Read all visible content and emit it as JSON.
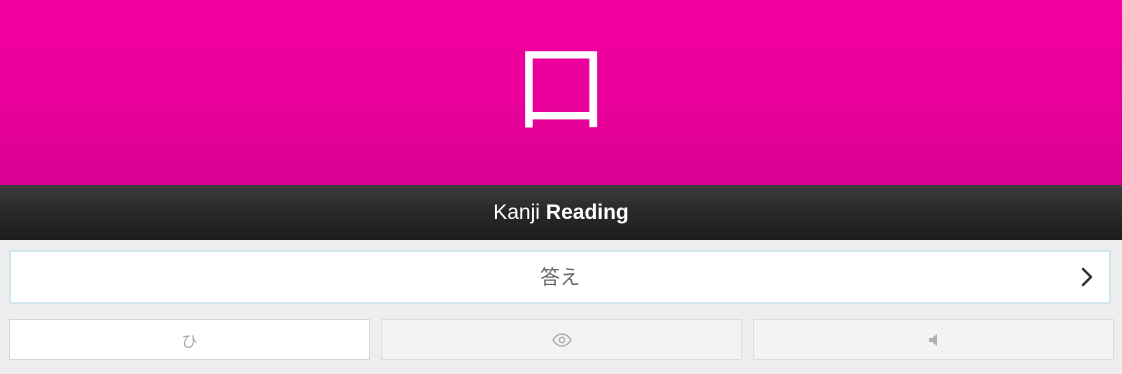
{
  "character": {
    "kanji": "口",
    "color": "#f000a0"
  },
  "header": {
    "item_type": "Kanji",
    "question_type": "Reading",
    "background": "#2a2a2a"
  },
  "answer": {
    "placeholder": "答え",
    "value": "",
    "submit_icon": "chevron-right-icon"
  },
  "buttons": {
    "kana_label": "ひ",
    "reveal_icon": "eye-icon",
    "audio_icon": "speaker-icon"
  }
}
